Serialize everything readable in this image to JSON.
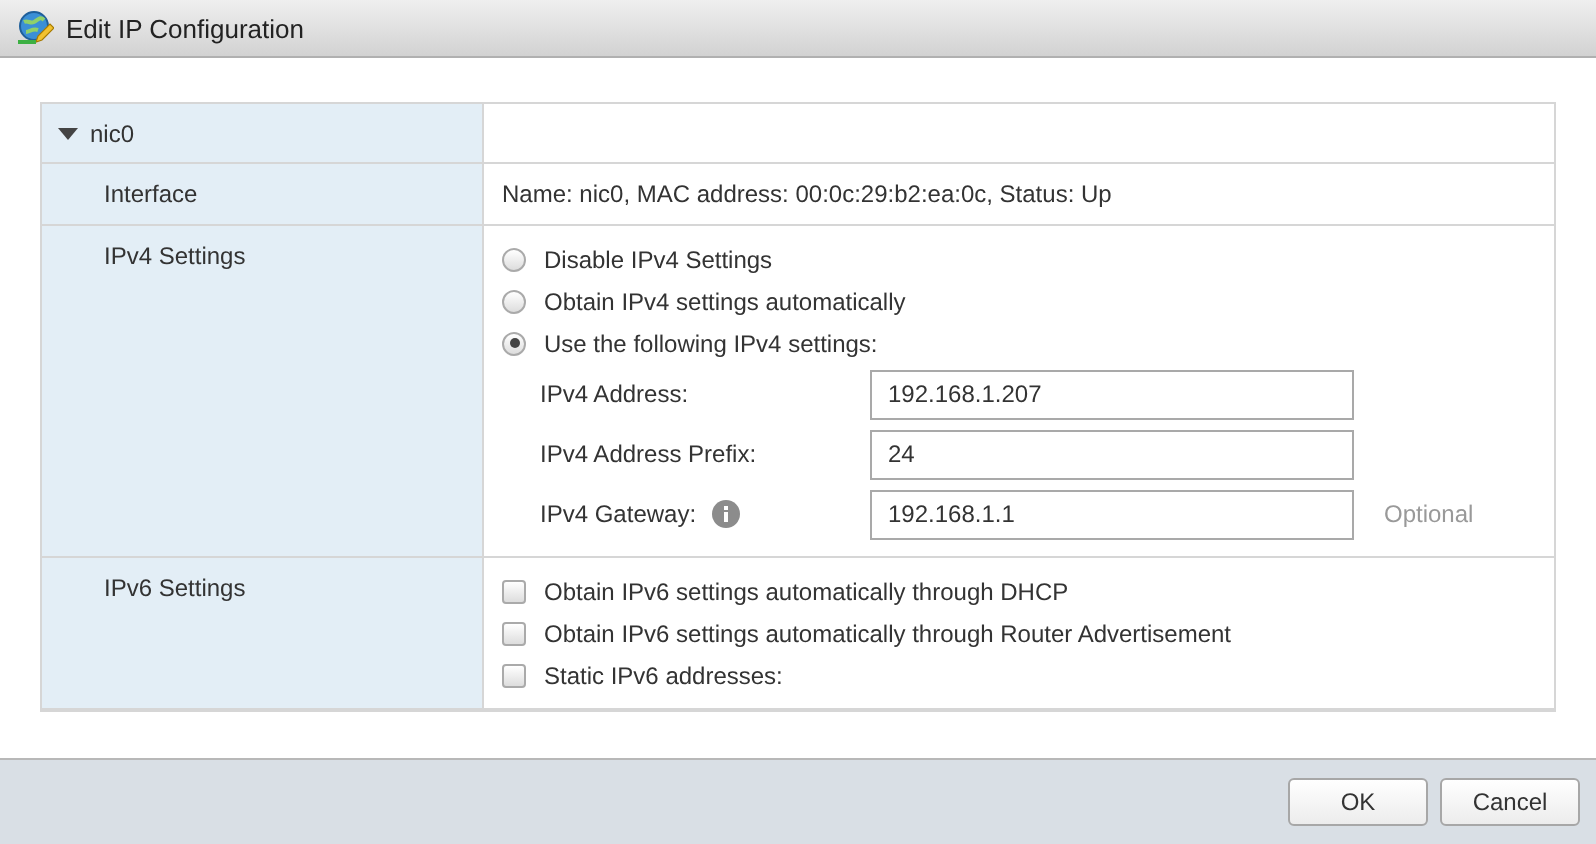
{
  "window": {
    "title": "Edit IP Configuration"
  },
  "nic": {
    "name": "nic0",
    "expanded": true
  },
  "interface": {
    "label": "Interface",
    "value": "Name: nic0, MAC address: 00:0c:29:b2:ea:0c, Status: Up"
  },
  "ipv4": {
    "label": "IPv4 Settings",
    "options": [
      {
        "label": "Disable IPv4 Settings",
        "selected": false
      },
      {
        "label": "Obtain IPv4 settings automatically",
        "selected": false
      },
      {
        "label": "Use the following IPv4 settings:",
        "selected": true
      }
    ],
    "fields": [
      {
        "label": "IPv4 Address:",
        "value": "192.168.1.207",
        "info": false
      },
      {
        "label": "IPv4 Address Prefix:",
        "value": "24",
        "info": false
      },
      {
        "label": "IPv4 Gateway:",
        "value": "192.168.1.1",
        "info": true,
        "note": "Optional"
      }
    ]
  },
  "ipv6": {
    "label": "IPv6 Settings",
    "options": [
      {
        "label": "Obtain IPv6 settings automatically through DHCP",
        "checked": false
      },
      {
        "label": "Obtain IPv6 settings automatically through Router Advertisement",
        "checked": false
      },
      {
        "label": "Static IPv6 addresses:",
        "checked": false
      }
    ]
  },
  "buttons": [
    {
      "label": "OK"
    },
    {
      "label": "Cancel"
    }
  ]
}
